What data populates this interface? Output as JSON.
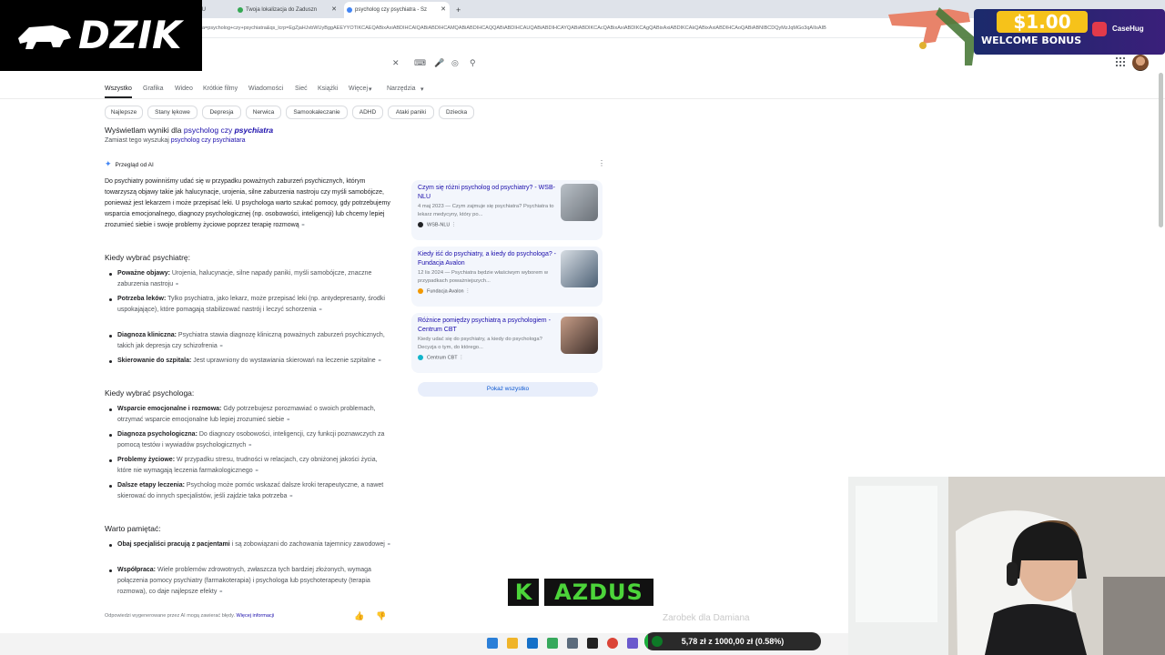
{
  "browser": {
    "tabs": [
      {
        "label": "EWU",
        "color": "#5f6368"
      },
      {
        "label": "Twoja lokalizacja do Zaduszn",
        "color": "#34a853"
      },
      {
        "label": "psycholog czy psychiatra - Sz",
        "color": "#4285f4"
      }
    ],
    "new_tab": "+",
    "url": "a=psycholog+czy+psychiatra&qs_lcrp=EgZjaHJvbWUyBggAEEYYOTIKCAEQABixAxiABDIHCAIQABiABDIHCAMQABiABDIHCAQQABiABDIHCAUQABiABDIHCAYQABiABDIKCAcQABixAxiABDIKCAgQABixAxiABDIKCAkQABixAxiABDIHCAoQABiABNIBCDQyMzJqMGo3qAIIsAIB"
  },
  "search_bar": {
    "clear_icon": "close-icon",
    "keyboard_icon": "keyboard-icon",
    "mic_icon": "mic-icon",
    "lens_icon": "lens-icon",
    "search_icon": "search-icon"
  },
  "nav": {
    "tabs": [
      "Wszystko",
      "Grafika",
      "Wideo",
      "Krótkie filmy",
      "Wiadomości",
      "Sieć",
      "Książki",
      "Więcej",
      "Narzędzia"
    ],
    "more_arrow": "▾"
  },
  "chips": [
    "Najlepsze",
    "Stany lękowe",
    "Depresja",
    "Nerwica",
    "Samookaleczanie",
    "ADHD",
    "Ataki paniki",
    "Dziecka"
  ],
  "spelling": {
    "showing_prefix": "Wyświetlam wyniki dla",
    "showing_a": "psycholog czy",
    "showing_b": "psychiatra",
    "instead_prefix": "Zamiast tego wyszukaj",
    "instead_query": "psycholog czy psychiatara"
  },
  "ai_overview": {
    "header": "Przegląd od AI",
    "intro": "Do psychiatry powinniśmy udać się w przypadku poważnych zaburzeń psychicznych, którym towarzyszą objawy takie jak halucynacje, urojenia, silne zaburzenia nastroju czy myśli samobójcze, ponieważ jest lekarzem i może przepisać leki. U psychologa warto szukać pomocy, gdy potrzebujemy wsparcia emocjonalnego, diagnozy psychologicznej (np. osobowości, inteligencji) lub chcemy lepiej zrozumieć siebie i swoje problemy życiowe poprzez terapię rozmową",
    "h1": "Kiedy wybrać psychiatrę:",
    "list1": [
      {
        "bold": "Poważne objawy:",
        "text": "Urojenia, halucynacje, silne napady paniki, myśli samobójcze, znaczne zaburzenia nastroju"
      },
      {
        "bold": "Potrzeba leków:",
        "text": "Tylko psychiatra, jako lekarz, może przepisać leki (np. antydepresanty, środki uspokajające), które pomagają stabilizować nastrój i leczyć schorzenia"
      },
      {
        "bold": "Diagnoza kliniczna:",
        "text": "Psychiatra stawia diagnozę kliniczną poważnych zaburzeń psychicznych, takich jak depresja czy schizofrenia"
      },
      {
        "bold": "Skierowanie do szpitala:",
        "text": "Jest uprawniony do wystawiania skierowań na leczenie szpitalne"
      }
    ],
    "h2": "Kiedy wybrać psychologa:",
    "list2": [
      {
        "bold": "Wsparcie emocjonalne i rozmowa:",
        "text": "Gdy potrzebujesz porozmawiać o swoich problemach, otrzymać wsparcie emocjonalne lub lepiej zrozumieć siebie"
      },
      {
        "bold": "Diagnoza psychologiczna:",
        "text": "Do diagnozy osobowości, inteligencji, czy funkcji poznawczych za pomocą testów i wywiadów psychologicznych"
      },
      {
        "bold": "Problemy życiowe:",
        "text": "W przypadku stresu, trudności w relacjach, czy obniżonej jakości życia, które nie wymagają leczenia farmakologicznego"
      },
      {
        "bold": "Dalsze etapy leczenia:",
        "text": "Psycholog może pomóc wskazać dalsze kroki terapeutyczne, a nawet skierować do innych specjalistów, jeśli zajdzie taka potrzeba"
      }
    ],
    "h3": "Warto pamiętać:",
    "list3": [
      {
        "bold": "Obaj specjaliści pracują z pacjentami",
        "text": "i są zobowiązani do zachowania tajemnicy zawodowej"
      },
      {
        "bold": "Współpraca:",
        "text": "Wiele problemów zdrowotnych, zwłaszcza tych bardziej złożonych, wymaga połączenia pomocy psychiatry (farmakoterapia) i psychologa lub psychoterapeuty (terapia rozmowa), co daje najlepsze efekty"
      }
    ],
    "footer_note": "Odpowiedzi wygenerowane przez AI mogą zawierać błędy.",
    "footer_link": "Więcej informacji",
    "show_all": "Pokaż wszystko"
  },
  "sources": [
    {
      "title": "Czym się różni psycholog od psychiatry? - WSB-NLU",
      "desc": "4 maj 2023 — Czym zajmuje się psychiatra? Psychiatra to lekarz medycyny, który po...",
      "site": "WSB-NLU",
      "icon_color": "#202124",
      "thumb_color": "#8a9299"
    },
    {
      "title": "Kiedy iść do psychiatry, a kiedy do psychologa? - Fundacja Avalon",
      "desc": "12 lis 2024 — Psychiatra będzie właściwym wyborem w przypadkach poważniejszych...",
      "site": "Fundacja Avalon",
      "icon_color": "#f29900",
      "thumb_color": "#6d7f92"
    },
    {
      "title": "Różnice pomiędzy psychiatrą a psychologiem - Centrum CBT",
      "desc": "Kiedy udać się do psychiatry, a kiedy do psychologa? Decyzja o tym, do którego...",
      "site": "Centrum CBT",
      "icon_color": "#12b5cb",
      "thumb_color": "#5a4b44"
    }
  ],
  "overlay": {
    "logo_text": "DZIK",
    "bonus_amount": "$1.00",
    "bonus_label": "WELCOME BONUS",
    "bonus_brand": "CaseHug",
    "banner_k": "K",
    "banner_rest": "AZDUS",
    "goal_label": "Zarobek dla Damiana",
    "goal_text": "5,78 zł z 1000,00 zł (0.58%)",
    "goal_fraction": 0.0058
  }
}
